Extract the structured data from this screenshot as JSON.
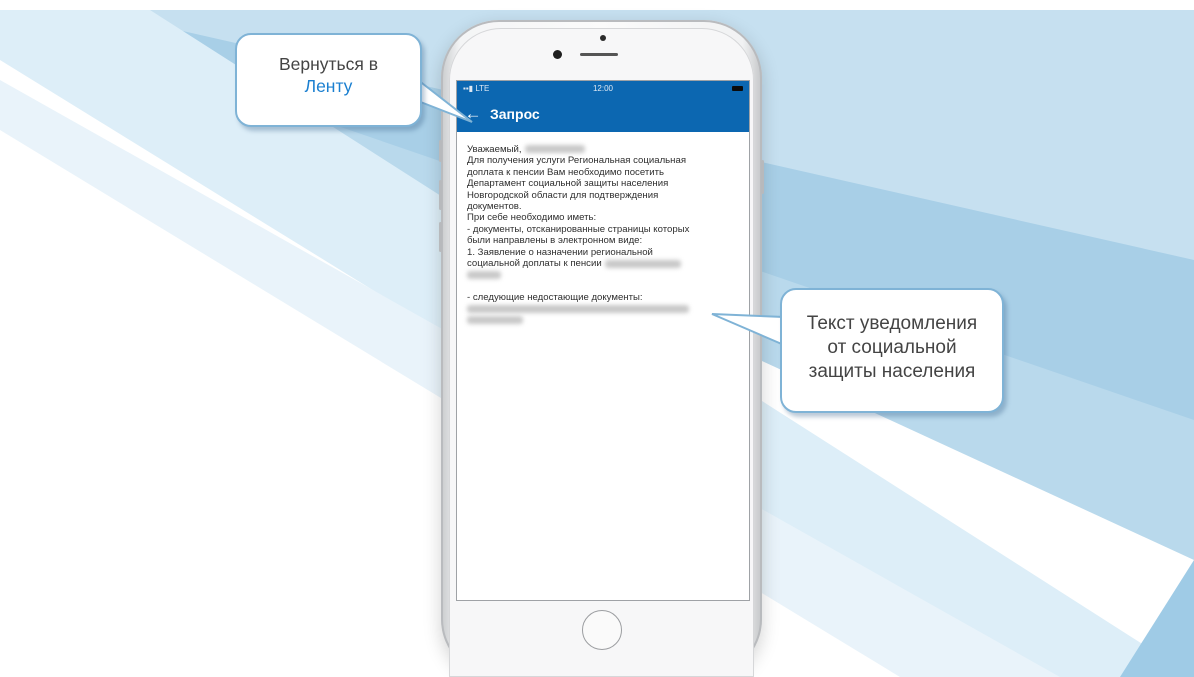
{
  "status_bar": {
    "network": "LTE",
    "time": "12:00"
  },
  "app_bar": {
    "back_icon": "arrow-left-icon",
    "title": "Запрос"
  },
  "notification": {
    "lines": [
      "Уважаемый,",
      "Для получения услуги Региональная социальная",
      "доплата к пенсии Вам необходимо посетить",
      "Департамент социальной защиты населения",
      "Новгородской области для подтверждения",
      "документов.",
      "При себе необходимо иметь:",
      "- документы, отсканированные страницы которых",
      "были направлены в электронном виде:",
      "1. Заявление о назначении региональной",
      "социальной доплаты к пенсии",
      "- следующие недостающие документы:"
    ]
  },
  "callouts": {
    "back": {
      "line1": "Вернуться в",
      "line2": "Ленту"
    },
    "notice": {
      "line1": "Текст уведомления",
      "line2": "от социальной",
      "line3": "защиты населения"
    }
  },
  "colors": {
    "app_bar": "#0c67b1",
    "link_accent": "#1a7fd0",
    "callout_border": "#7fb3d6"
  }
}
